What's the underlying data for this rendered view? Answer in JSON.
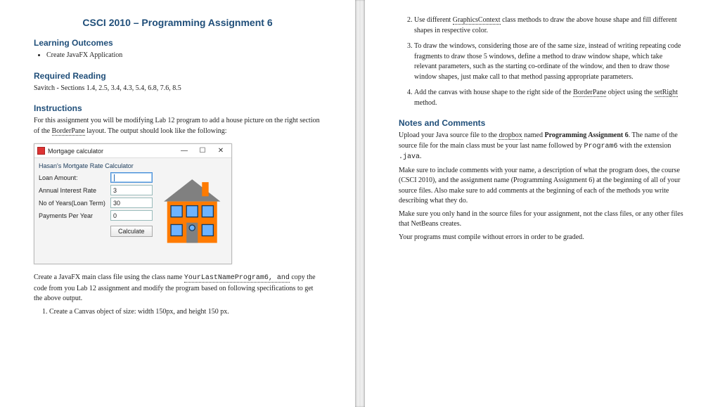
{
  "title": "CSCI 2010 – Programming Assignment 6",
  "sections": {
    "outcomes": "Learning Outcomes",
    "reading": "Required Reading",
    "instructions": "Instructions",
    "notes": "Notes and Comments"
  },
  "outcome_item": "Create JavaFX Application",
  "reading_text": "Savitch - Sections 1.4, 2.5, 3.4, 4.3, 5.4, 6.8, 7.6, 8.5",
  "instr_intro_a": "For this assignment you will be modifying Lab 12 program to add a house picture on the right section of the ",
  "instr_intro_b": "BorderPane",
  "instr_intro_c": " layout.  The output should look like the following:",
  "app": {
    "title": "Mortgage calculator",
    "form_title": "Hasan's Mortgate Rate Calculator",
    "loan_lbl": "Loan Amount:",
    "loan_val": "",
    "rate_lbl": "Annual Interest Rate",
    "rate_val": "3",
    "years_lbl": "No of Years(Loan Term)",
    "years_val": "30",
    "pay_lbl": "Payments Per Year",
    "pay_val": "0",
    "calc_btn": "Calculate",
    "min": "—",
    "max": "☐",
    "close": "✕"
  },
  "below_app_a": "Create a JavaFX main class file using the class name ",
  "below_app_b": "YourLastNameProgram6, and",
  "below_app_c": " copy the code from you Lab 12 assignment and modify the program based on following specifications to get the above output.",
  "step1": "Create a Canvas object of size: width 150px, and height 150 px.",
  "step2_a": "Use different ",
  "step2_b": "GraphicsContext",
  "step2_c": " class methods to draw the above house shape and fill different shapes in respective color.",
  "step3": "To draw the windows, considering those are of the same size, instead of writing repeating code fragments to draw those 5 windows, define a method to draw window shape, which take relevant parameters, such as the starting co-ordinate of the window, and then to draw those window shapes, just make call to that method passing appropriate parameters.",
  "step4_a": "Add the canvas with house shape to the right side of the ",
  "step4_b": "BorderPane",
  "step4_c": " object using the ",
  "step4_d": "setRight",
  "step4_e": " method.",
  "notes_p1_a": "Upload your Java source file to the ",
  "notes_p1_b": "dropbox",
  "notes_p1_c": " named ",
  "notes_p1_d": "Programming Assignment 6",
  "notes_p1_e": ". The name of the source file for the main class must be your last name followed by ",
  "notes_p1_f": "Program6",
  "notes_p1_g": " with the extension ",
  "notes_p1_h": ".java",
  "notes_p1_i": ".",
  "notes_p2": "Make sure to include comments with your name, a description of what the program does, the course (CSCI 2010), and the assignment name (Programming Assignment 6) at the beginning of all of your source files. Also make sure to add comments at the beginning of each of the methods you write describing what they do.",
  "notes_p3": "Make sure you only hand in the source files for your assignment, not the class files, or any other files that NetBeans creates.",
  "notes_p4": "Your programs must compile without errors in order to be graded."
}
